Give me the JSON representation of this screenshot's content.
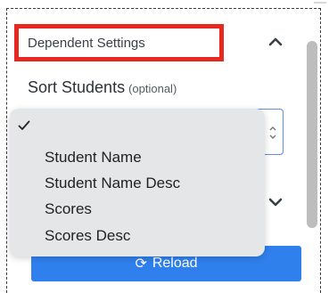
{
  "section": {
    "title": "Dependent Settings"
  },
  "sort_field": {
    "label": "Sort Students",
    "optional_hint": "(optional)"
  },
  "dropdown": {
    "options": [
      "Student Name",
      "Student Name Desc",
      "Scores",
      "Scores Desc"
    ]
  },
  "actions": {
    "reload_label": "Reload"
  },
  "icons": {
    "collapse": "chevron-up-icon",
    "expand": "chevron-down-icon",
    "selected": "checkmark-icon",
    "reload": "refresh-icon",
    "select_arrows": "updown-arrows-icon"
  },
  "colors": {
    "highlight": "#e8281f",
    "primary": "#2f80ed",
    "focus": "#5b8fe0"
  }
}
